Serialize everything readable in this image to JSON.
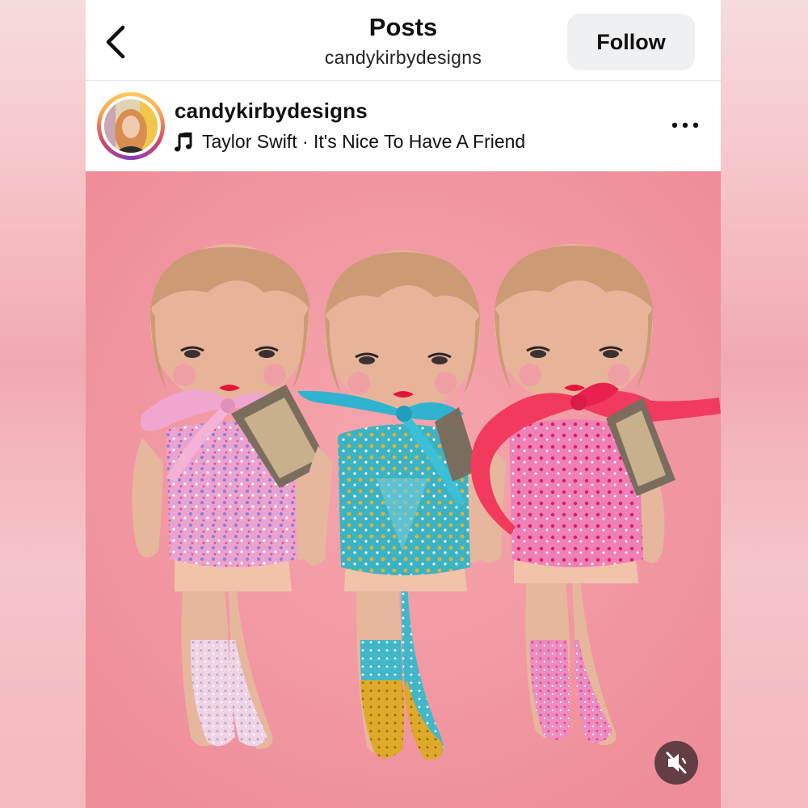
{
  "header": {
    "back_icon": "chevron-left-icon",
    "title": "Posts",
    "subtitle": "candykirbydesigns",
    "follow_label": "Follow"
  },
  "post": {
    "username": "candykirbydesigns",
    "audio_icon": "music-note-icon",
    "audio_text": "Taylor Swift · It's Nice To Have A Friend",
    "more_icon": "more-dots-icon"
  },
  "media": {
    "mute_icon": "speaker-muted-icon",
    "colors": {
      "background": "#f39aa4",
      "doll_pink": "#ea9cc8",
      "doll_teal": "#3db4c4",
      "doll_hotpink": "#e8559a",
      "ribbon_pink": "#f1a6cf",
      "ribbon_teal": "#2fb3cf",
      "ribbon_red": "#f23a5e"
    }
  }
}
